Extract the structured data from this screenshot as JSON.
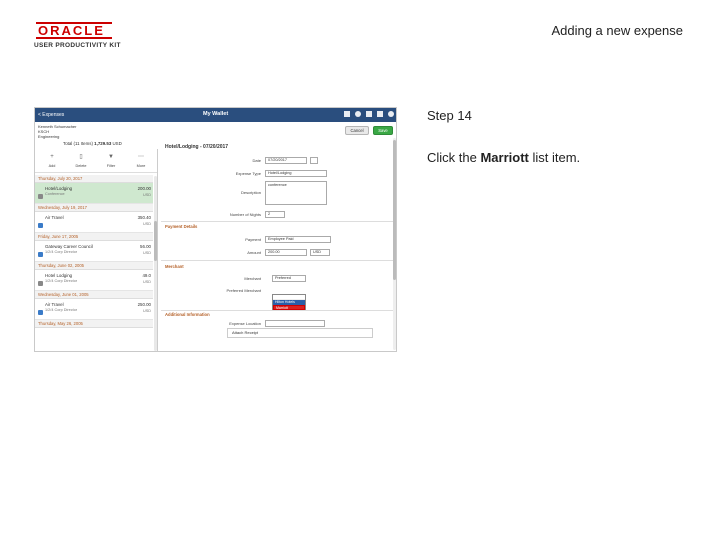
{
  "slide": {
    "title": "Adding a new expense",
    "logo_main": "ORACLE",
    "logo_sub": "USER PRODUCTIVITY KIT",
    "step": "Step 14",
    "instruction_pre": "Click the ",
    "instruction_bold": "Marriott",
    "instruction_post": " list item."
  },
  "app": {
    "back_label": "< Expenses",
    "title": "My Wallet",
    "user_name": "Kenneth Schumacher",
    "user_id": "KSCH",
    "user_role": "Engineering",
    "total_label": "Total (11 Items)",
    "total_amount": "1,729.53",
    "total_currency": "USD",
    "cancel_label": "Cancel",
    "save_label": "Save"
  },
  "toolbar": [
    {
      "label": "Add",
      "icon": "plus-icon"
    },
    {
      "label": "Delete",
      "icon": "trash-icon"
    },
    {
      "label": "Filter",
      "icon": "filter-icon"
    },
    {
      "label": "More",
      "icon": "more-icon"
    }
  ],
  "list": {
    "groups": [
      {
        "date": "Thursday, July 20, 2017",
        "items": [
          {
            "name": "Hotel/Lodging",
            "sub": "Conference",
            "amount": "200.00",
            "currency": "USD",
            "selected": true
          }
        ]
      },
      {
        "date": "Wednesday, July 19, 2017",
        "items": [
          {
            "name": "Air Travel",
            "sub": "",
            "amount": "350.40",
            "currency": "USD",
            "selected": false
          }
        ]
      },
      {
        "date": "Friday, June 17, 2005",
        "items": [
          {
            "name": "Gateway Career Council",
            "sub": "1/2/4 Corp Director",
            "amount": "56.00",
            "currency": "USD",
            "selected": false
          }
        ]
      },
      {
        "date": "Thursday, June 02, 2005",
        "items": [
          {
            "name": "Hotel Lodging",
            "sub": "1/2/4 Corp Director",
            "amount": "49.0",
            "currency": "USD",
            "selected": false
          }
        ]
      },
      {
        "date": "Wednesday, June 01, 2005",
        "items": [
          {
            "name": "Air Travel",
            "sub": "1/2/4 Corp Director",
            "amount": "250.00",
            "currency": "USD",
            "selected": false
          }
        ]
      },
      {
        "date": "Thursday, May 26, 2005",
        "items": []
      }
    ]
  },
  "form": {
    "title": "Hotel/Lodging - 07/20/2017",
    "date_label": "Date",
    "date_value": "07/20/2017",
    "expense_type_label": "Expense Type",
    "expense_type_value": "Hotel/Lodging",
    "description_label": "Description",
    "description_value": "conference",
    "nights_label": "Number of Nights",
    "nights_value": "2",
    "payment_section": "Payment Details",
    "payment_label": "Payment",
    "payment_value": "Employee Paid",
    "amount_label": "Amount",
    "amount_value": "200.00",
    "currency_value": "USD",
    "merchant_section": "Merchant",
    "merchant_label": "Merchant",
    "merchant_value": "Preferred",
    "pref_merchant_label": "Preferred Merchant",
    "dropdown_options": [
      "",
      "Hilton Hotels",
      "Marriott"
    ],
    "additional_section": "Additional Information",
    "expense_location_label": "Expense Location",
    "expense_location_value": "",
    "attach_label": "Attach Receipt"
  }
}
